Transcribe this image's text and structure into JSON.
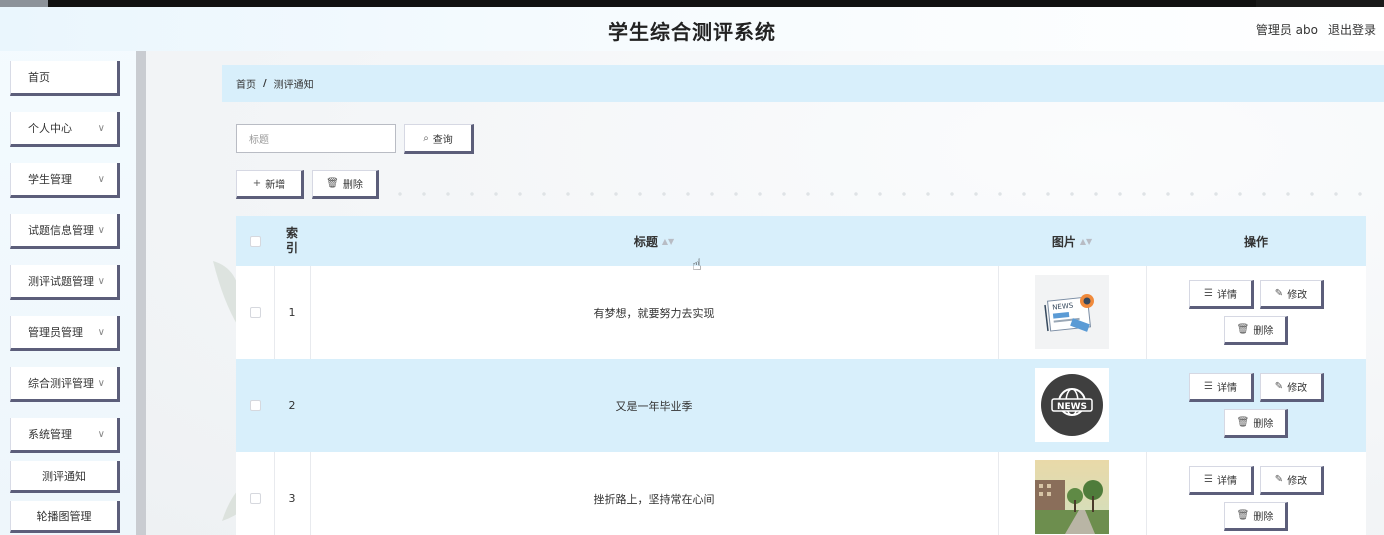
{
  "header": {
    "title": "学生综合测评系统",
    "user": "管理员 abo",
    "logout": "退出登录"
  },
  "sidebar": {
    "items": [
      {
        "label": "首页",
        "expandable": false
      },
      {
        "label": "个人中心",
        "expandable": true
      },
      {
        "label": "学生管理",
        "expandable": true
      },
      {
        "label": "试题信息管理",
        "expandable": true
      },
      {
        "label": "测评试题管理",
        "expandable": true
      },
      {
        "label": "管理员管理",
        "expandable": true
      },
      {
        "label": "综合测评管理",
        "expandable": true
      },
      {
        "label": "系统管理",
        "expandable": true
      }
    ],
    "subitems": [
      {
        "label": "测评通知"
      },
      {
        "label": "轮播图管理"
      }
    ]
  },
  "breadcrumb": {
    "home": "首页",
    "separator": "/",
    "current": "测评通知"
  },
  "search": {
    "placeholder": "标题",
    "button": "查询"
  },
  "actions": {
    "add": "新增",
    "delete": "删除"
  },
  "table": {
    "columns": {
      "index": "索引",
      "title": "标题",
      "image": "图片",
      "ops": "操作"
    },
    "rows": [
      {
        "index": "1",
        "title": "有梦想，就要努力去实现",
        "image": "news-illustration"
      },
      {
        "index": "2",
        "title": "又是一年毕业季",
        "image": "news-globe-icon"
      },
      {
        "index": "3",
        "title": "挫折路上，坚持常在心间",
        "image": "campus-photo"
      }
    ],
    "row_buttons": {
      "detail": "详情",
      "edit": "修改",
      "delete": "删除"
    }
  },
  "colors": {
    "accent_border": "#5c5e7a",
    "header_blue": "#d8effb"
  }
}
